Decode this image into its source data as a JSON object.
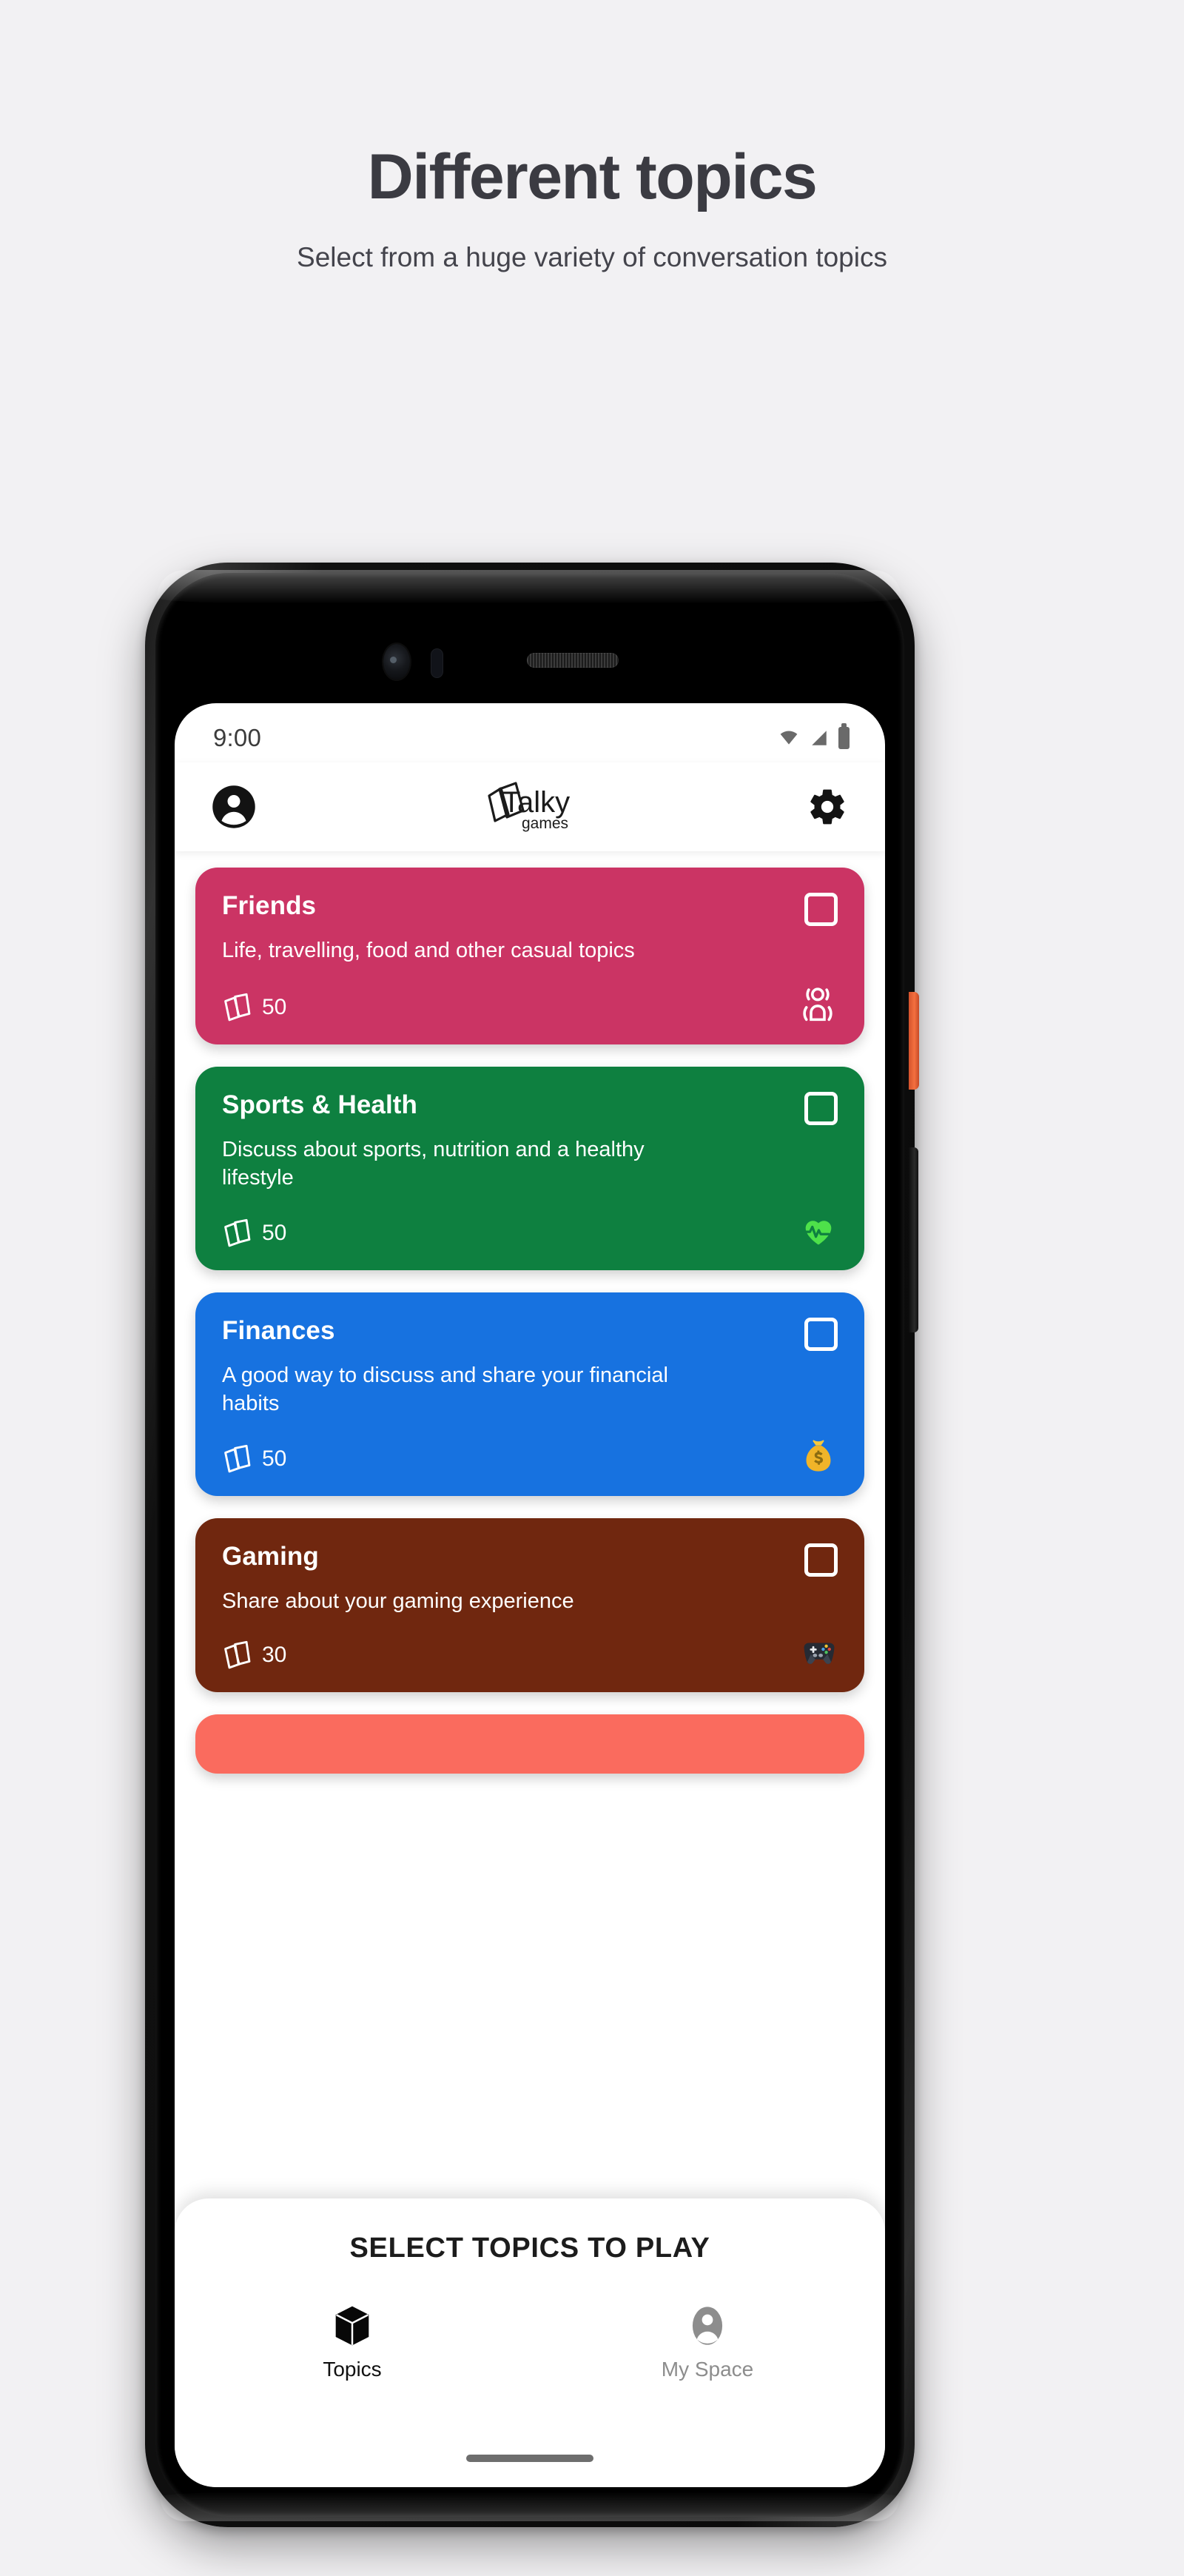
{
  "promo": {
    "title": "Different topics",
    "subtitle": "Select from a huge variety of conversation topics"
  },
  "device": {
    "power_button": "power-button",
    "volume_button": "volume-rocker",
    "home_indicator": "home-indicator"
  },
  "status_bar": {
    "time": "9:00",
    "icons": [
      "wifi-icon",
      "cellular-signal-icon",
      "battery-icon"
    ]
  },
  "app_bar": {
    "profile_icon": "account-circle-icon",
    "settings_icon": "gear-icon",
    "logo_main": "Talky",
    "logo_sub": "games"
  },
  "topics": [
    {
      "title": "Friends",
      "description": "Life, travelling, food and other casual topics",
      "count": "50",
      "color": "#cb3464",
      "emoji": "🗣",
      "emoji_name": "speaking-head-icon",
      "selected": false
    },
    {
      "title": "Sports & Health",
      "description": "Discuss about sports, nutrition and a healthy lifestyle",
      "count": "50",
      "color": "#0e8040",
      "emoji": "💚",
      "emoji_name": "green-heart-pulse-icon",
      "selected": false
    },
    {
      "title": "Finances",
      "description": "A good way to discuss and share your financial habits",
      "count": "50",
      "color": "#1772e0",
      "emoji": "💰",
      "emoji_name": "money-bag-icon",
      "selected": false
    },
    {
      "title": "Gaming",
      "description": "Share about your gaming experience",
      "count": "30",
      "color": "#70270f",
      "emoji": "🎮",
      "emoji_name": "video-game-controller-icon",
      "selected": false
    },
    {
      "title": "",
      "description": "",
      "count": "",
      "color": "#fa6b5e",
      "emoji": "",
      "emoji_name": "",
      "selected": false
    }
  ],
  "bottom_sheet": {
    "title": "SELECT TOPICS TO PLAY",
    "tabs": [
      {
        "label": "Topics",
        "icon": "cube-icon",
        "active": true
      },
      {
        "label": "My Space",
        "icon": "person-icon",
        "active": false
      }
    ]
  },
  "colors": {
    "page_bg": "#f2f1f3",
    "heading": "#3b3b42",
    "accent_salmon": "#fa6b5e",
    "inactive_tab": "#8d8d8d"
  }
}
